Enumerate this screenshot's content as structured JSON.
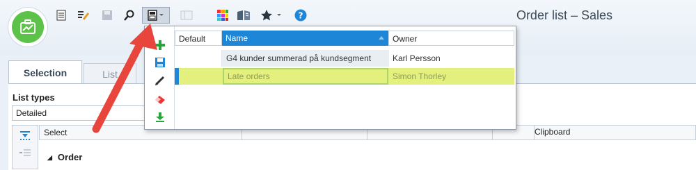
{
  "window": {
    "title": "Order list – Sales"
  },
  "toolbar": {
    "icons": [
      "list-icon",
      "edit-list-icon",
      "save-icon",
      "search-icon",
      "saved-lists-icon",
      "columns-icon",
      "color-grid-icon",
      "book-icon",
      "favorites-star-icon",
      "help-icon"
    ],
    "active": "saved-lists-icon"
  },
  "tabs": {
    "selection": "Selection",
    "list": "List"
  },
  "list_types": {
    "label": "List types",
    "value": "Detailed"
  },
  "grid": {
    "select_header": "Select",
    "clipboard_header": "Clipboard",
    "group_label": "Order"
  },
  "popup": {
    "columns": {
      "default": "Default",
      "name": "Name",
      "owner": "Owner"
    },
    "rows": [
      {
        "default": "",
        "name": "G4 kunder summerad på kundsegment",
        "owner": "Karl Persson"
      },
      {
        "default": "",
        "name": "Late orders",
        "owner": "Simon Thorley"
      }
    ],
    "actions": [
      "add-icon",
      "save-icon",
      "edit-pencil-icon",
      "eraser-icon",
      "download-icon"
    ]
  },
  "colors": {
    "accent": "#1d86d6",
    "highlight": "#e4f07d",
    "logo": "#5cc24a",
    "arrow": "#e8453c"
  }
}
